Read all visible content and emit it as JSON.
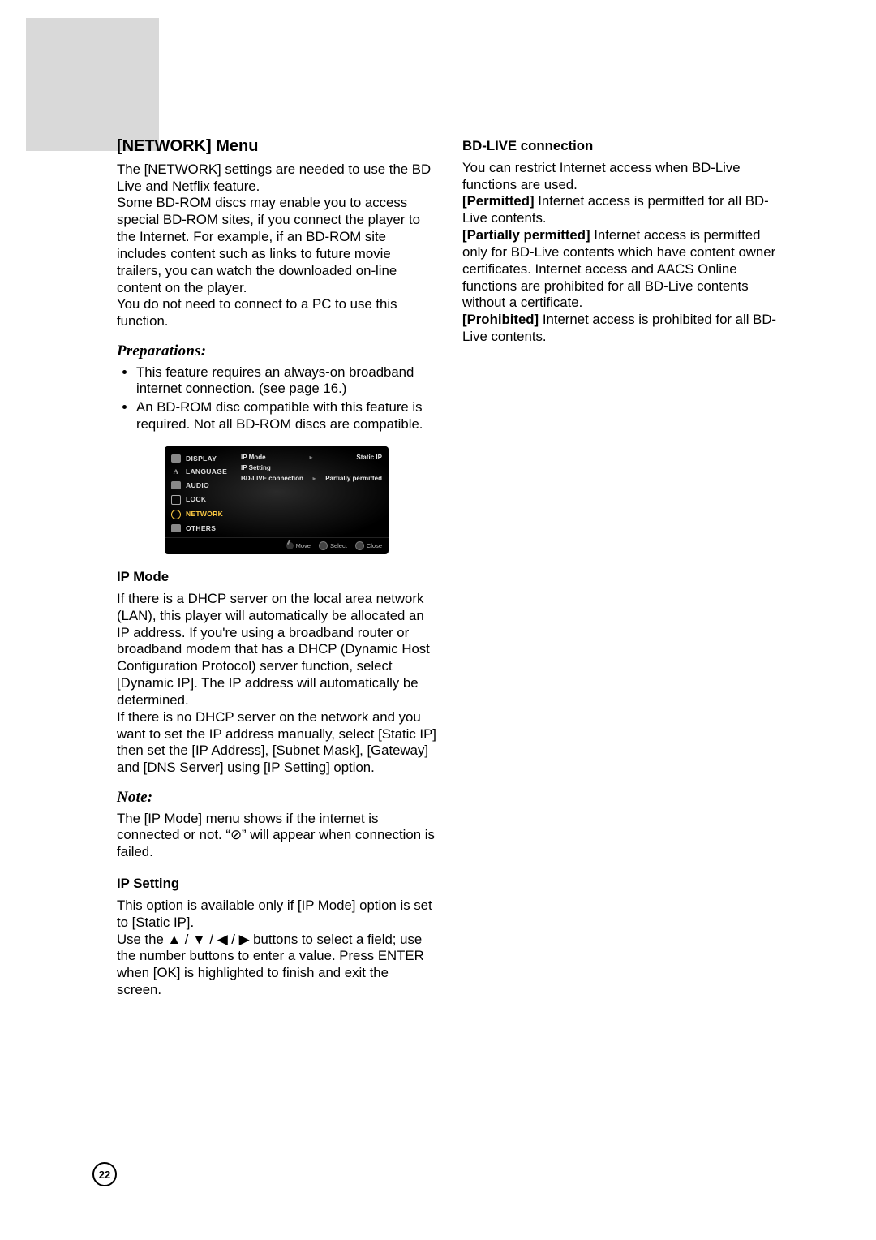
{
  "page_number": "22",
  "left": {
    "heading": "[NETWORK] Menu",
    "intro_p1": "The [NETWORK] settings are needed to use the BD Live and Netflix feature.",
    "intro_p2": "Some BD-ROM discs may enable you to access special BD-ROM sites, if you connect the player to the Internet. For example, if an BD-ROM site includes content such as links to future movie trailers, you can watch the downloaded on-line content on the player.",
    "intro_p3": "You do not need to connect to a PC to use this function.",
    "preparations_heading": "Preparations:",
    "prep_b1": "This feature requires an always-on broadband internet connection. (see page 16.)",
    "prep_b2": "An BD-ROM disc compatible with this feature is required. Not all BD-ROM discs are compatible.",
    "screenshot": {
      "sidebar": [
        "DISPLAY",
        "LANGUAGE",
        "AUDIO",
        "LOCK",
        "NETWORK",
        "OTHERS"
      ],
      "sidebar_selected_index": 4,
      "rows": [
        {
          "label": "IP Mode",
          "value": "Static IP"
        },
        {
          "label": "IP Setting",
          "value": ""
        },
        {
          "label": "BD-LIVE connection",
          "value": "Partially permitted"
        }
      ],
      "footer": {
        "move": "Move",
        "select": "Select",
        "close": "Close"
      }
    },
    "ipmode_heading": "IP Mode",
    "ipmode_p1": "If there is a DHCP server on the local area network (LAN), this player will automatically be allocated an IP address. If you're using a broadband router or broadband modem that has a DHCP (Dynamic Host Configuration Protocol) server function, select [Dynamic IP]. The IP address will automatically be determined.",
    "ipmode_p2": "If there is no DHCP server on the network and you want to set the IP address manually, select [Static IP] then set the [IP Address], [Subnet Mask], [Gateway] and [DNS Server] using [IP Setting] option.",
    "note_heading": "Note:",
    "note_p_pre": "The [IP Mode] menu shows if the internet is connected or not. “",
    "note_symbol": "⊘",
    "note_p_post": "” will appear when connection is failed.",
    "ipsetting_heading": "IP Setting",
    "ipsetting_p1": "This option is available only if [IP Mode] option is set to [Static IP].",
    "ipsetting_p2_pre": "Use the ",
    "ipsetting_arrows": "▲ / ▼ / ◀ / ▶",
    "ipsetting_p2_post": " buttons to select a field; use the number buttons to enter a value. Press ENTER when [OK] is highlighted to finish and exit the screen."
  },
  "right": {
    "bdlive_heading": "BD-LIVE connection",
    "bdlive_intro": "You can restrict Internet access when BD-Live functions are used.",
    "permitted_label": "[Permitted]",
    "permitted_text": " Internet access is permitted for all BD-Live contents.",
    "partial_label": "[Partially permitted]",
    "partial_text": " Internet access is permitted only for BD-Live contents which have content owner certificates. Internet access and AACS Online functions are prohibited for all BD-Live contents without a certificate.",
    "prohibited_label": "[Prohibited]",
    "prohibited_text": " Internet access is prohibited for all BD-Live contents."
  }
}
